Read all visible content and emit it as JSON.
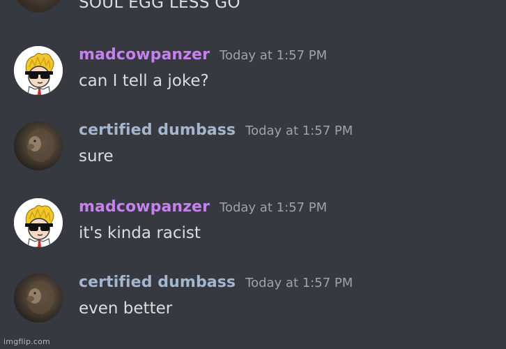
{
  "partial_message": {
    "text": "SOUL EGG LESS GO"
  },
  "messages": [
    {
      "username": "madcowpanzer",
      "timestamp": "Today at 1:57 PM",
      "content": "can I tell a joke?",
      "avatar": "wsb-guy-sunglasses-avatar",
      "name_color": "#c680f0"
    },
    {
      "username": "certified dumbass",
      "timestamp": "Today at 1:57 PM",
      "content": "sure",
      "avatar": "lion-avatar",
      "name_color": "#a5b5ce"
    },
    {
      "username": "madcowpanzer",
      "timestamp": "Today at 1:57 PM",
      "content": "it's kinda racist",
      "avatar": "wsb-guy-sunglasses-avatar",
      "name_color": "#c680f0"
    },
    {
      "username": "certified dumbass",
      "timestamp": "Today at 1:57 PM",
      "content": "even better",
      "avatar": "lion-avatar",
      "name_color": "#a5b5ce"
    }
  ],
  "watermark": "imgflip.com",
  "colors": {
    "background": "#36393f",
    "text": "#dcddde",
    "timestamp": "#a0a3a8"
  }
}
